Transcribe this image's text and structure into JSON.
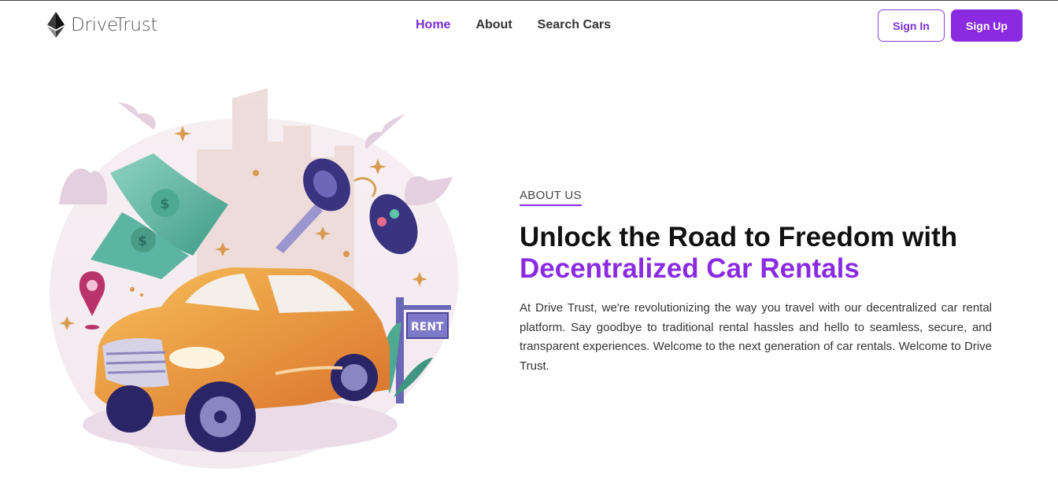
{
  "brand": {
    "name": "DriveTrust",
    "icon": "ethereum-logo-icon"
  },
  "nav": {
    "items": [
      {
        "label": "Home",
        "active": true
      },
      {
        "label": "About",
        "active": false
      },
      {
        "label": "Search Cars",
        "active": false
      }
    ]
  },
  "auth": {
    "sign_in": "Sign In",
    "sign_up": "Sign Up"
  },
  "hero": {
    "eyebrow": "ABOUT US",
    "title_line1": "Unlock the Road to Freedom with",
    "title_line2": "Decentralized Car Rentals",
    "description": "At Drive Trust, we're revolutionizing the way you travel with our decentralized car rental platform. Say goodbye to traditional rental hassles and hello to seamless, secure, and transparent experiences. Welcome to the next generation of car rentals. Welcome to Drive Trust.",
    "illustration": {
      "sign_text": "RENT",
      "icon": "car-rental-illustration"
    }
  },
  "colors": {
    "accent": "#8a2be2",
    "text": "#111111",
    "muted": "#555555"
  }
}
